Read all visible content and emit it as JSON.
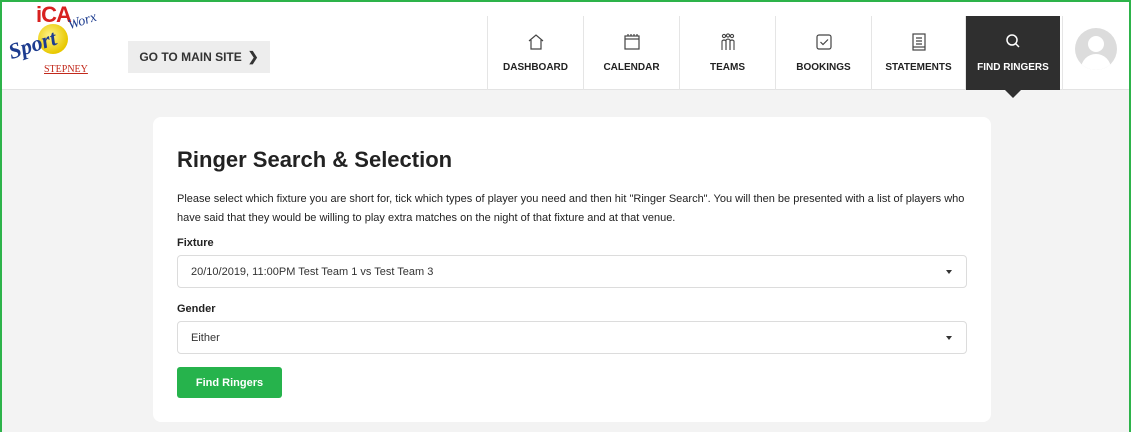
{
  "header": {
    "logo": {
      "ica": "iCA",
      "sport": "Sport",
      "worx": "Worx",
      "stepney": "STEPNEY"
    },
    "main_site_label": "GO TO MAIN SITE",
    "nav": [
      {
        "label": "DASHBOARD",
        "icon": "home-icon"
      },
      {
        "label": "CALENDAR",
        "icon": "calendar-icon"
      },
      {
        "label": "TEAMS",
        "icon": "teams-icon"
      },
      {
        "label": "BOOKINGS",
        "icon": "bookings-icon"
      },
      {
        "label": "STATEMENTS",
        "icon": "statements-icon"
      },
      {
        "label": "FIND RINGERS",
        "icon": "search-icon",
        "active": true
      }
    ]
  },
  "main": {
    "title": "Ringer Search & Selection",
    "description": "Please select which fixture you are short for, tick which types of player you need and then hit \"Ringer Search\". You will then be presented with a list of players who have said that they would be willing to play extra matches on the night of that fixture and at that venue.",
    "fixture_label": "Fixture",
    "fixture_value": "20/10/2019, 11:00PM Test Team 1 vs Test Team 3",
    "gender_label": "Gender",
    "gender_value": "Either",
    "find_button": "Find Ringers"
  },
  "colors": {
    "accent": "#26b34c",
    "nav_active": "#2f2f2f",
    "frame": "#2db34a"
  }
}
